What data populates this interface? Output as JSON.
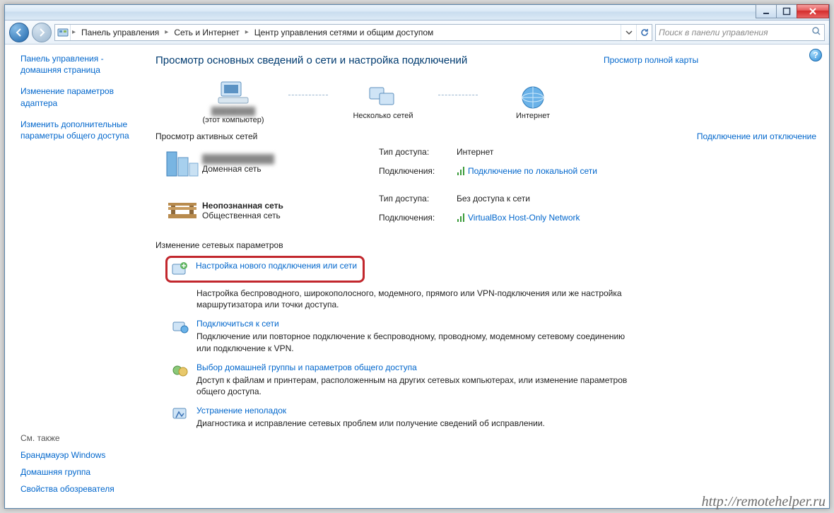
{
  "titlebar": {
    "min": "",
    "max": "",
    "close": ""
  },
  "breadcrumbs": {
    "b1": "Панель управления",
    "b2": "Сеть и Интернет",
    "b3": "Центр управления сетями и общим доступом"
  },
  "search": {
    "placeholder": "Поиск в панели управления"
  },
  "sidebar": {
    "home": "Панель управления - домашняя страница",
    "l1": "Изменение параметров адаптера",
    "l2": "Изменить дополнительные параметры общего доступа",
    "seealso": "См. также",
    "s1": "Брандмауэр Windows",
    "s2": "Домашняя группа",
    "s3": "Свойства обозревателя"
  },
  "main": {
    "title": "Просмотр основных сведений о сети и настройка подключений",
    "node1": "(этот компьютер)",
    "node2": "Несколько сетей",
    "node3": "Интернет",
    "mapfull": "Просмотр полной карты",
    "activehdr": "Просмотр активных сетей",
    "conntoggle": "Подключение или отключение",
    "net1": {
      "name": "Доменная сеть",
      "name_blur": "",
      "type_k": "Тип доступа:",
      "type_v": "Интернет",
      "conn_k": "Подключения:",
      "conn_v": "Подключение по локальной сети"
    },
    "net2": {
      "name": "Неопознанная сеть",
      "sub": "Общественная сеть",
      "type_k": "Тип доступа:",
      "type_v": "Без доступа к сети",
      "conn_k": "Подключения:",
      "conn_v": "VirtualBox Host-Only Network"
    },
    "changehdr": "Изменение сетевых параметров",
    "a1": {
      "t": "Настройка нового подключения или сети",
      "d": "Настройка беспроводного, широкополосного, модемного, прямого или VPN-подключения или же настройка маршрутизатора или точки доступа."
    },
    "a2": {
      "t": "Подключиться к сети",
      "d": "Подключение или повторное подключение к беспроводному, проводному, модемному сетевому соединению или подключение к VPN."
    },
    "a3": {
      "t": "Выбор домашней группы и параметров общего доступа",
      "d": "Доступ к файлам и принтерам, расположенным на других сетевых компьютерах, или изменение параметров общего доступа."
    },
    "a4": {
      "t": "Устранение неполадок",
      "d": "Диагностика и исправление сетевых проблем или получение сведений об исправлении."
    }
  },
  "watermark": "http://remotehelper.ru"
}
